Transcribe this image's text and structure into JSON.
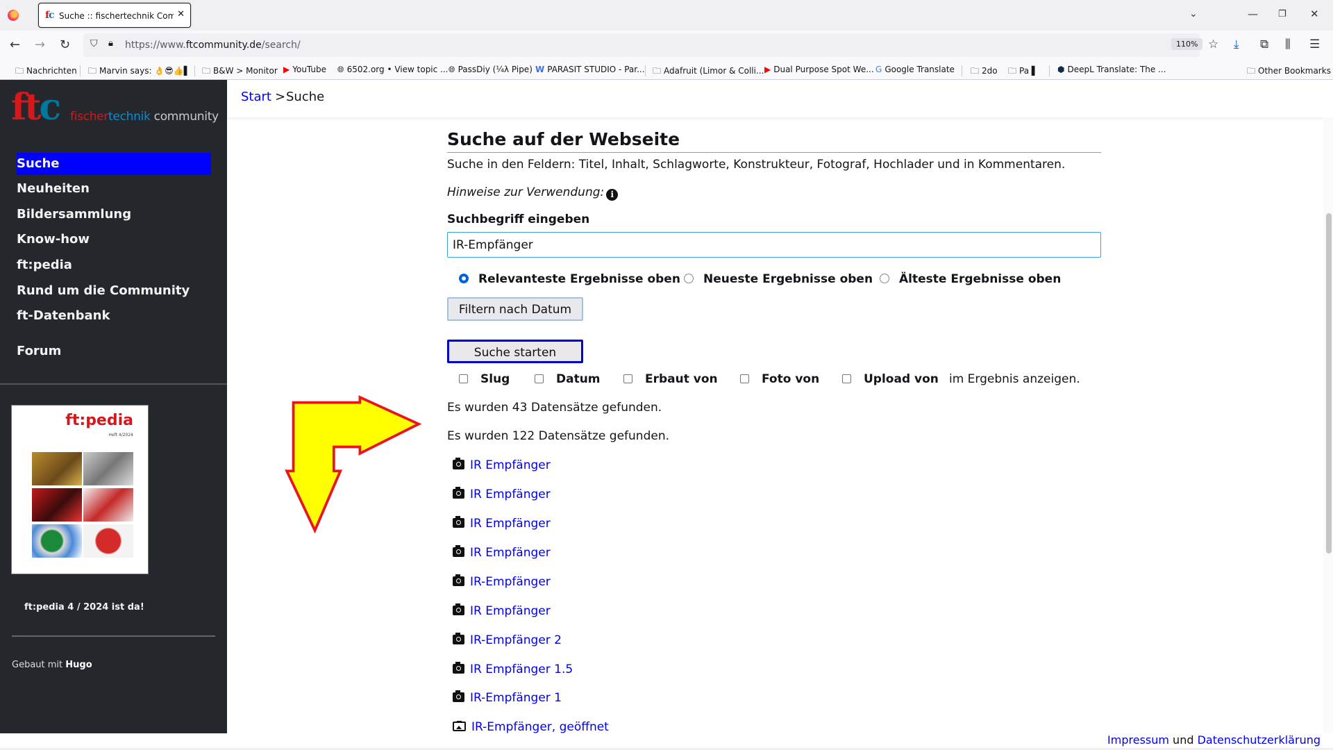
{
  "browser": {
    "tab_title": "Suche :: fischertechnik Community",
    "url_prefix": "https://www.",
    "url_domain": "ftcommunity.de",
    "url_path": "/search/",
    "zoom": "110%",
    "bookmarks": [
      {
        "icon": "folder",
        "label": "Nachrichten"
      },
      {
        "icon": "folder",
        "label": "Marvin says: 👌😎👍▌"
      },
      {
        "icon": "folder",
        "label": "B&W > Monitor"
      },
      {
        "icon": "youtube",
        "label": "YouTube"
      },
      {
        "icon": "globe",
        "label": "6502.org • View topic ..."
      },
      {
        "icon": "globe",
        "label": "PassDiy (¼λ Pipe)"
      },
      {
        "icon": "w",
        "label": "PARASIT STUDIO - Par..."
      },
      {
        "icon": "folder",
        "label": "Adafruit (Limor & Colli..."
      },
      {
        "icon": "youtube",
        "label": "Dual Purpose Spot We..."
      },
      {
        "icon": "translate",
        "label": "Google Translate"
      },
      {
        "icon": "folder",
        "label": "2do"
      },
      {
        "icon": "folder",
        "label": "Pa ▌"
      },
      {
        "icon": "deepl",
        "label": "DeepL Translate: The ..."
      },
      {
        "icon": "folder",
        "label": "Other Bookmarks"
      }
    ]
  },
  "sidebar": {
    "logo_ftc": "ft",
    "logo_c": "c",
    "logo_sub_1": "fischer",
    "logo_sub_2": "technik",
    "logo_sub_3": " community",
    "items": [
      "Suche",
      "Neuheiten",
      "Bildersammlung",
      "Know-how",
      "ft:pedia",
      "Rund um die Community",
      "ft-Datenbank",
      "Forum"
    ],
    "magazine_title_1": "ft",
    "magazine_title_2": ":pedia",
    "magazine_heft": "Heft 4/2024",
    "magazine_caption": "ft:pedia 4 / 2024 ist da!",
    "built_prefix": "Gebaut mit ",
    "built_name": "Hugo"
  },
  "breadcrumb": {
    "start": "Start",
    "separator": ">",
    "current": "Suche"
  },
  "main": {
    "heading": "Suche auf der Webseite",
    "description": "Suche in den Feldern: Titel, Inhalt, Schlagworte, Konstrukteur, Fotograf, Hochlader und in Kommentaren.",
    "hint": "Hinweise zur Verwendung:",
    "search_label": "Suchbegriff eingeben",
    "search_value": "IR-Empfänger",
    "sort_options": [
      "Relevanteste Ergebnisse oben",
      "Neueste Ergebnisse oben",
      "Älteste Ergebnisse oben"
    ],
    "filter_button": "Filtern nach Datum",
    "start_button": "Suche starten",
    "show_fields": [
      "Slug",
      "Datum",
      "Erbaut von",
      "Foto von",
      "Upload von"
    ],
    "show_fields_suffix": "im Ergebnis anzeigen.",
    "count_1": "Es wurden 43 Datensätze gefunden.",
    "count_2": "Es wurden 122 Datensätze gefunden.",
    "results": [
      "IR Empfänger",
      "IR Empfänger",
      "IR Empfänger",
      "IR Empfänger",
      "IR-Empfänger",
      "IR Empfänger",
      "IR-Empfänger 2",
      "IR Empfänger 1.5",
      "IR-Empfänger 1",
      "IR-Empfänger, geöffnet"
    ]
  },
  "footer": {
    "impressum": "Impressum",
    "und": " und ",
    "datenschutz": "Datenschutzerklärung"
  },
  "colors": {
    "accent_blue": "#0000ff",
    "link": "#0000ee",
    "sidebar_bg": "#24282d",
    "arrow_fill": "#ffff00",
    "arrow_stroke": "#e8141e"
  }
}
